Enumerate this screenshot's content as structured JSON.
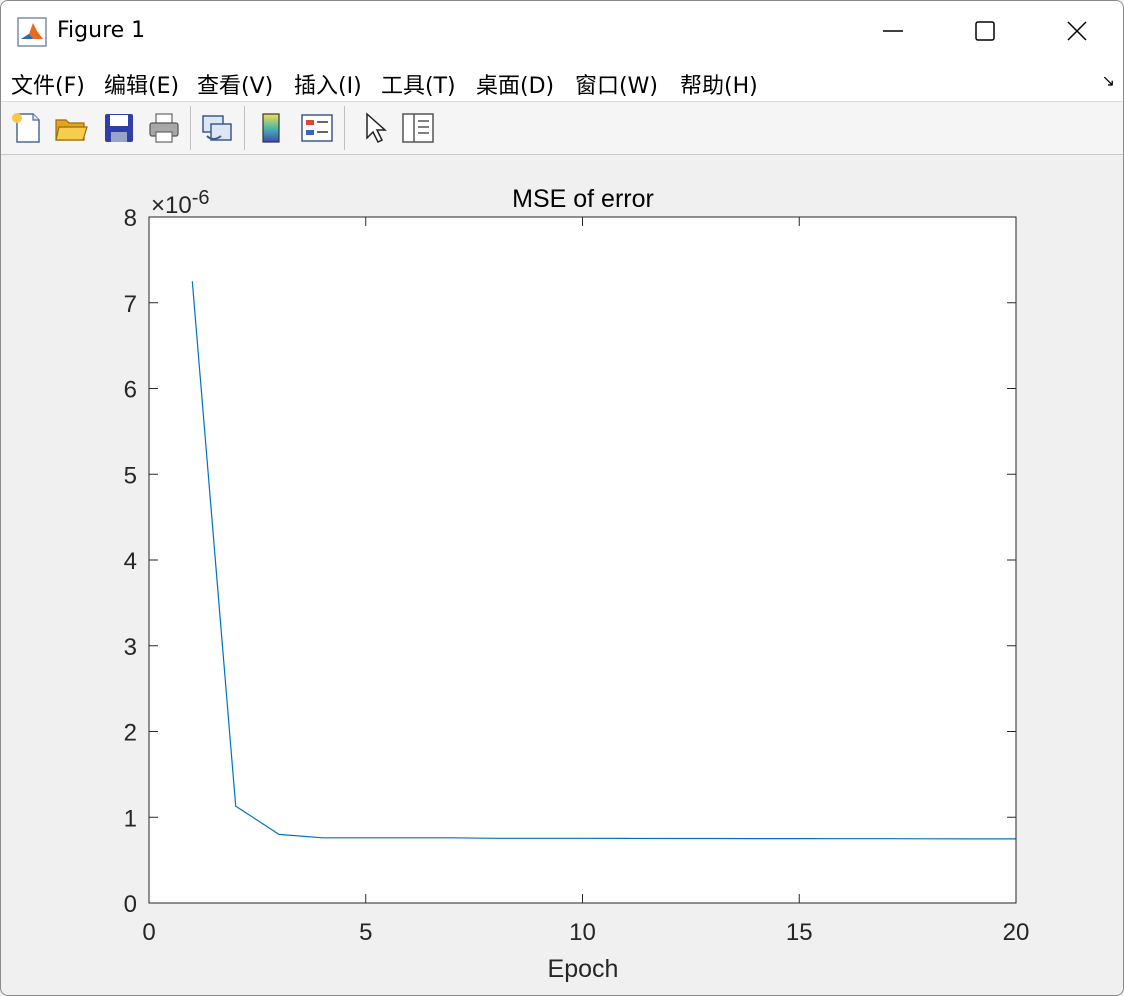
{
  "window": {
    "title": "Figure 1"
  },
  "menu": {
    "items": [
      {
        "label": "文件(F)"
      },
      {
        "label": "编辑(E)"
      },
      {
        "label": "查看(V)"
      },
      {
        "label": "插入(I)"
      },
      {
        "label": "工具(T)"
      },
      {
        "label": "桌面(D)"
      },
      {
        "label": "窗口(W)"
      },
      {
        "label": "帮助(H)"
      }
    ]
  },
  "toolbar": {
    "buttons": [
      "new-figure-icon",
      "open-file-icon",
      "save-icon",
      "print-icon",
      "link-plot-icon",
      "colorbar-icon",
      "legend-icon",
      "pointer-icon",
      "property-inspector-icon"
    ]
  },
  "chart_data": {
    "type": "line",
    "title": "MSE of error",
    "xlabel": "Epoch",
    "ylabel": "",
    "exponent_label": "×10⁻⁶",
    "exponent_base": "×10",
    "exponent_power": "-6",
    "xlim": [
      0,
      20
    ],
    "ylim": [
      0,
      8
    ],
    "xticks": [
      "0",
      "5",
      "10",
      "15",
      "20"
    ],
    "yticks": [
      "0",
      "1",
      "2",
      "3",
      "4",
      "5",
      "6",
      "7",
      "8"
    ],
    "grid": false,
    "series": [
      {
        "color": "#0072BD",
        "x": [
          1,
          2,
          3,
          4,
          5,
          6,
          7,
          8,
          9,
          10,
          11,
          12,
          13,
          14,
          15,
          16,
          17,
          18,
          19,
          20
        ],
        "y": [
          7.25,
          1.13,
          0.8,
          0.76,
          0.76,
          0.76,
          0.76,
          0.755,
          0.755,
          0.755,
          0.753,
          0.752,
          0.752,
          0.751,
          0.751,
          0.75,
          0.75,
          0.749,
          0.748,
          0.748
        ]
      }
    ]
  }
}
